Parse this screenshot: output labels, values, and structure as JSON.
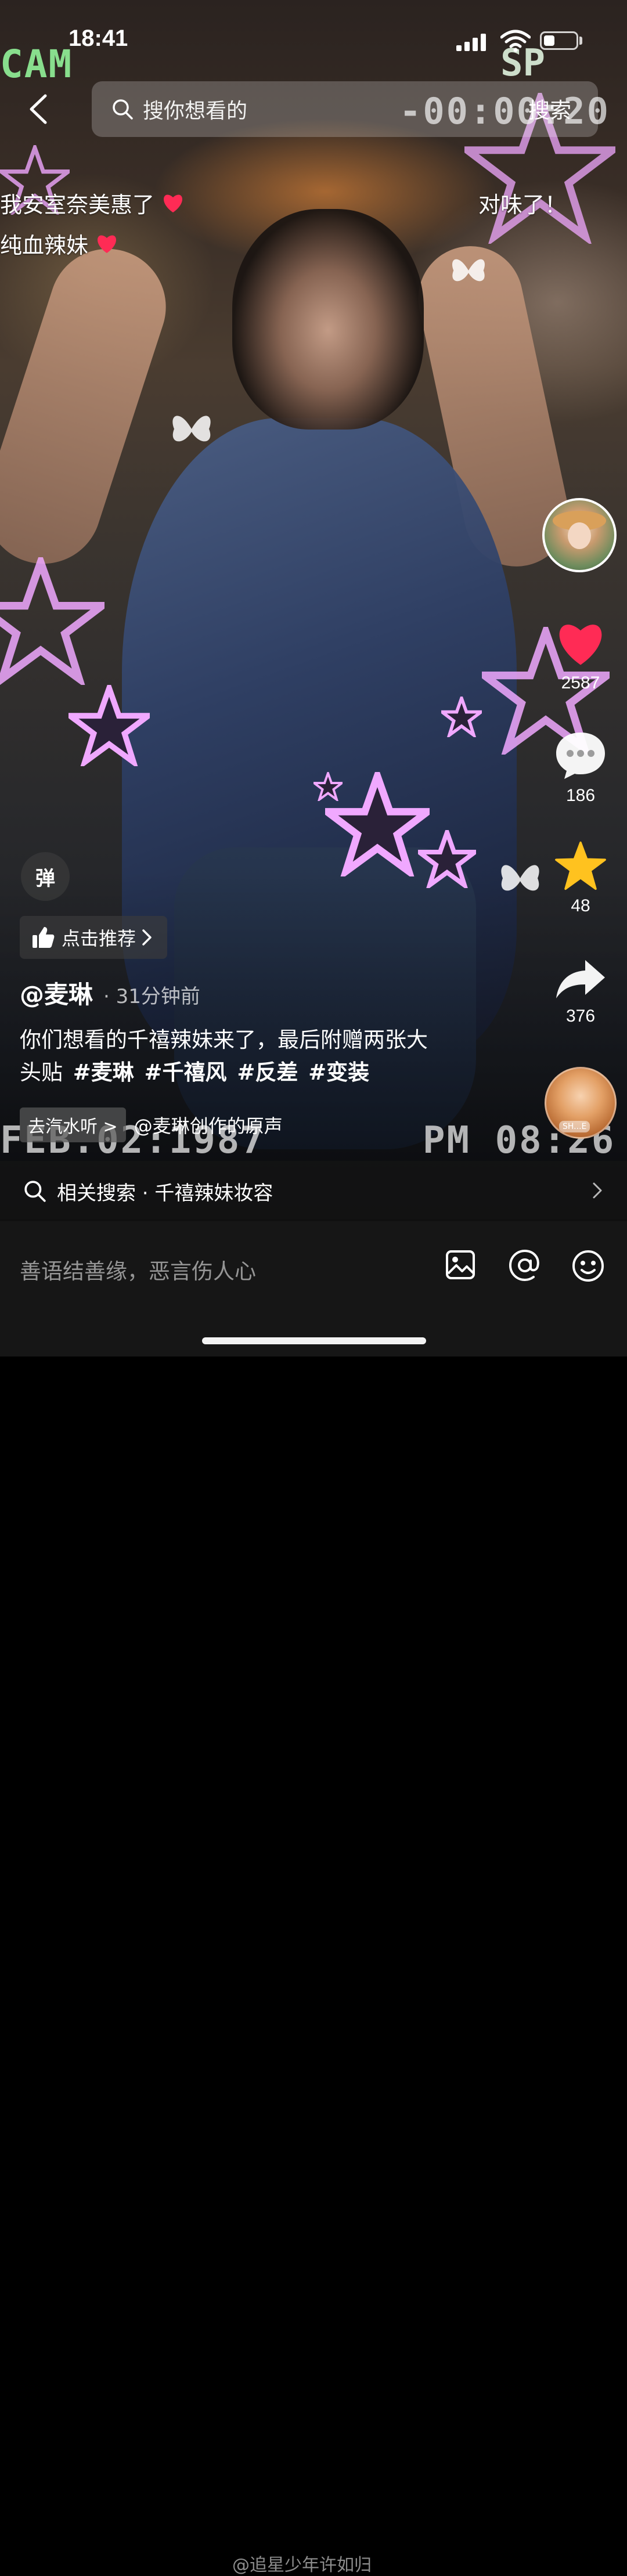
{
  "status_bar": {
    "time": "18:41",
    "battery_level": 0.35
  },
  "overlay": {
    "cam_label": "CAM",
    "cam_sp": "SP",
    "cam_counter": "-00:00:20",
    "cam_date": "FEB.02:1987",
    "cam_clock": "PM 08:26"
  },
  "search": {
    "placeholder": "搜你想看的",
    "button": "搜索"
  },
  "danmu": [
    {
      "text": "我安室奈美惠了"
    },
    {
      "text": "纯血辣妹"
    },
    {
      "text": "对味了！"
    }
  ],
  "actions": {
    "likes": "2587",
    "comments": "186",
    "favorites": "48",
    "shares": "376",
    "disc_label": "SH...E"
  },
  "left_controls": {
    "danmu_toggle": "弹",
    "recommend": "点击推荐"
  },
  "post": {
    "author": "@麦琳",
    "time_ago": "· 31分钟前",
    "caption_line1": "你们想看的千禧辣妹来了，最后附赠两张大",
    "caption_line2": "头贴",
    "hashtags": [
      "#麦琳",
      "#千禧风",
      "#反差",
      "#变装"
    ],
    "music_chip": "去汽水听 >",
    "music_title": "@麦琳创作的原声"
  },
  "related_search": {
    "label": "相关搜索 · 千禧辣妹妆容"
  },
  "comment_bar": {
    "placeholder": "善语结善缘，恶言伤人心"
  },
  "watermark": "@追星少年许如归",
  "colors": {
    "like_red": "#ff2b55",
    "favorite_yellow": "#ffc21f",
    "star_pink": "#f0a8ff"
  }
}
